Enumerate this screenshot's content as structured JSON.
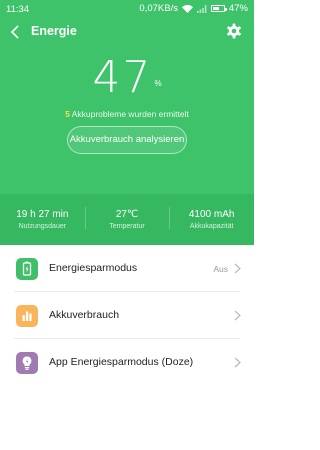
{
  "status_bar": {
    "time": "11:34",
    "speed": "0,07KB/s",
    "battery_text": "47%",
    "battery_level": 0.47
  },
  "header": {
    "title": "Energie",
    "back_icon": "chevron-left-icon",
    "settings_icon": "gear-icon"
  },
  "battery": {
    "percent": "47",
    "unit": "%"
  },
  "problems": {
    "count": "5",
    "text": " Akkuprobleme wurden ermittelt"
  },
  "analyze_button": "Akkuverbrauch analysieren",
  "stats": [
    {
      "value": "19 h 27 min",
      "label": "Nutzungsdauer"
    },
    {
      "value": "27℃",
      "label": "Temperatur"
    },
    {
      "value": "4100 mAh",
      "label": "Akkukapazität"
    }
  ],
  "menu": [
    {
      "label": "Energiesparmodus",
      "status": "Aus",
      "icon": "battery-saver-icon",
      "color": "#3fbf6a"
    },
    {
      "label": "Akkuverbrauch",
      "status": "",
      "icon": "bar-chart-icon",
      "color": "#f8b55c"
    },
    {
      "label": "App Energiesparmodus (Doze)",
      "status": "",
      "icon": "lightbulb-icon",
      "color": "#a07ab0"
    }
  ],
  "colors": {
    "primary_green": "#3ec26a",
    "stats_green": "#36b860",
    "problem_count": "#f6e547"
  }
}
